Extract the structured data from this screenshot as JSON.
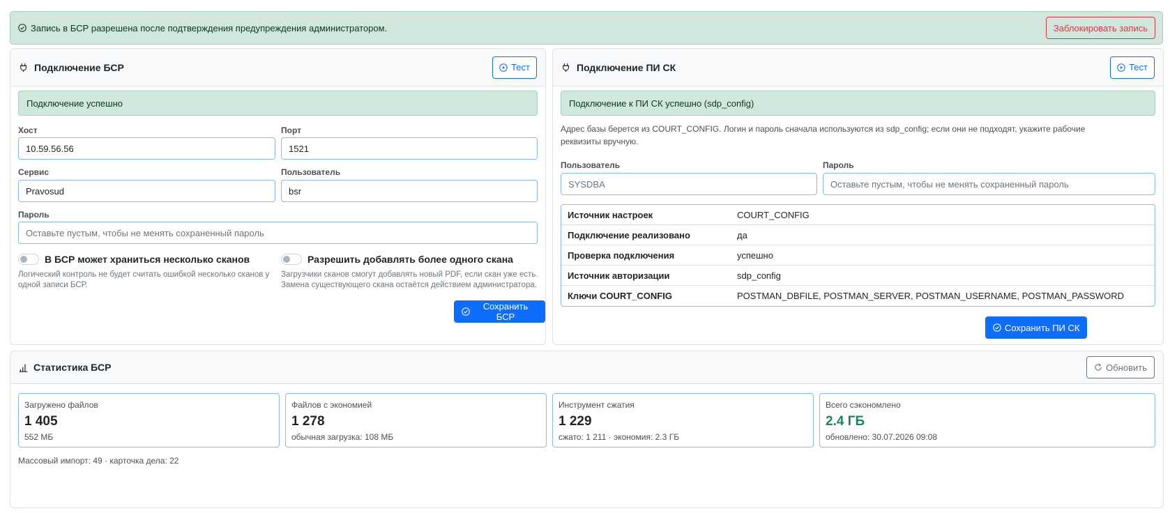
{
  "top_alert": {
    "message": "Запись в БСР разрешена после подтверждения предупреждения администратором.",
    "block_button": "Заблокировать запись"
  },
  "bsr": {
    "title": "Подключение БСР",
    "test_button": "Тест",
    "status": "Подключение успешно",
    "host_label": "Хост",
    "host_value": "10.59.56.56",
    "port_label": "Порт",
    "port_value": "1521",
    "service_label": "Сервис",
    "service_value": "Pravosud",
    "user_label": "Пользователь",
    "user_value": "bsr",
    "password_label": "Пароль",
    "password_placeholder": "Оставьте пустым, чтобы не менять сохраненный пароль",
    "switch1_label": "В БСР может храниться несколько сканов",
    "switch1_help1": "Логический контроль не будет считать ошибкой несколько сканов у",
    "switch1_help2": "одной записи БСР.",
    "switch2_label": "Разрешить добавлять более одного скана",
    "switch2_help1": "Загрузчики сканов смогут добавлять новый PDF, если скан уже есть.",
    "switch2_help2": "Замена существующего скана остаётся действием администратора.",
    "save_button": "Сохранить БСР"
  },
  "pisk": {
    "title": "Подключение ПИ СК",
    "test_button": "Тест",
    "status": "Подключение к ПИ СК успешно (sdp_config)",
    "note1": "Адрес базы берется из COURT_CONFIG. Логин и пароль сначала используются из sdp_config; если они не подходят, укажите рабочие",
    "note2": "реквизиты вручную.",
    "user_label": "Пользователь",
    "user_placeholder": "SYSDBA",
    "password_label": "Пароль",
    "password_placeholder": "Оставьте пустым, чтобы не менять сохраненный пароль",
    "rows": [
      {
        "key": "Источник настроек",
        "value": "COURT_CONFIG"
      },
      {
        "key": "Подключение реализовано",
        "value": "да"
      },
      {
        "key": "Проверка подключения",
        "value": "успешно"
      },
      {
        "key": "Источник авторизации",
        "value": "sdp_config"
      },
      {
        "key": "Ключи COURT_CONFIG",
        "value": "POSTMAN_DBFILE, POSTMAN_SERVER, POSTMAN_USERNAME, POSTMAN_PASSWORD"
      }
    ],
    "save_button": "Сохранить ПИ СК"
  },
  "stats": {
    "title": "Статистика БСР",
    "refresh_button": "Обновить",
    "boxes": [
      {
        "label": "Загружено файлов",
        "value": "1 405",
        "sub": "552 МБ"
      },
      {
        "label": "Файлов с экономией",
        "value": "1 278",
        "sub": "обычная загрузка: 108 МБ"
      },
      {
        "label": "Инструмент сжатия",
        "value": "1 229",
        "sub": "сжато: 1 211 · экономия: 2.3 ГБ"
      },
      {
        "label": "Всего сэкономлено",
        "value": "2.4 ГБ",
        "sub": "обновлено: 30.07.2026 09:08"
      }
    ],
    "footer": "Массовый импорт: 49 · карточка дела: 22"
  },
  "colors": {
    "success_bg": "#d1e7dd",
    "primary": "#0d6efd",
    "danger": "#dc3545",
    "green_value": "#198754"
  },
  "icons": [
    "check-circle-icon",
    "plug-icon",
    "play-circle-icon",
    "bar-chart-icon",
    "refresh-icon"
  ]
}
